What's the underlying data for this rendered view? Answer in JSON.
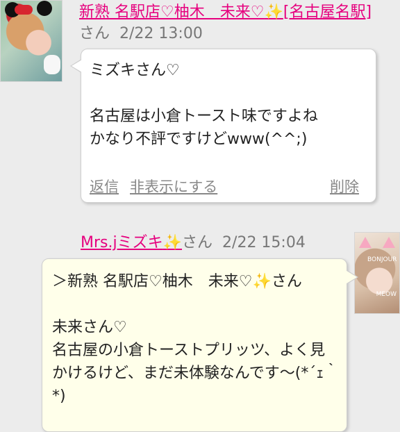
{
  "post1": {
    "author": "新熟 名駅店♡柚木　未来♡",
    "author_tail": "[名古屋名駅]",
    "honorific": "さん",
    "timestamp": "2/22 13:00",
    "message": "ミズキさん♡\n\n名古屋は小倉トースト味ですよね\nかなり不評ですけどwww(^^;)",
    "actions": {
      "reply": "返信",
      "hide": "非表示にする",
      "delete": "削除"
    }
  },
  "post2": {
    "author": "Mrs.jミズキ",
    "honorific": "さん",
    "timestamp": "2/22 15:04",
    "message": "＞新熟 名駅店♡柚木　未来♡✨さん\n\n未来さん♡\n名古屋の小倉トーストプリッツ、よく見かけるけど、まだ未体験なんです～(*´ｪ｀*)"
  },
  "sparkle": "✨",
  "avatar_caption": "BONJOUR",
  "avatar_caption2": "MEOW",
  "colors": {
    "author": "#e6007e",
    "sparkle": "#f5c400",
    "bubble_own": "#ffffea",
    "bubble_other": "#ffffff",
    "background": "#ececec"
  }
}
